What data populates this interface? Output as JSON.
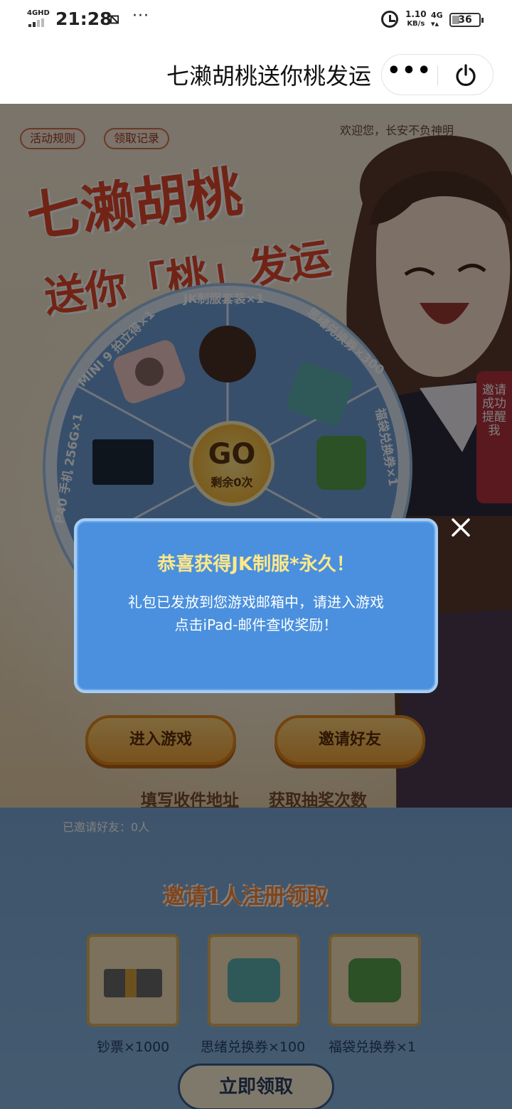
{
  "status": {
    "network": "4GHD",
    "time": "21:28",
    "speed": "1.10",
    "speed_unit": "KB/s",
    "mobile": "4G",
    "battery": "36"
  },
  "titlebar": {
    "title": "七濑胡桃送你桃发运"
  },
  "page": {
    "rules_btn": "活动规则",
    "records_btn": "领取记录",
    "welcome": "欢迎您，长安不负神明",
    "title_line1": "七濑胡桃",
    "title_line2": "送你「桃」发运",
    "wheel": {
      "prizes": [
        "JK制服套装×1",
        "思绪兑换券×300",
        "福袋兑换券×1",
        "P40 手机 256G×1",
        "MINI 9 拍立得×1"
      ],
      "go": "GO",
      "remaining": "剩余0次"
    },
    "side_tab": "邀请成功提醒我",
    "enter_game": "进入游戏",
    "invite_friends": "邀请好友",
    "fill_address": "填写收件地址",
    "get_chances": "获取抽奖次数",
    "invited_count": "已邀请好友：0人",
    "invite_title": "邀请1人注册领取",
    "rewards": [
      "钞票×1000",
      "思绪兑换券×100",
      "福袋兑换券×1"
    ],
    "claim_now": "立即领取"
  },
  "modal": {
    "title": "恭喜获得JK制服*永久！",
    "body_line1": "礼包已发放到您游戏邮箱中，请进入游戏",
    "body_line2": "点击iPad-邮件查收奖励！"
  },
  "colors": {
    "modal_bg": "#4a90de",
    "modal_title": "#ffe889",
    "accent": "#e2492b"
  }
}
